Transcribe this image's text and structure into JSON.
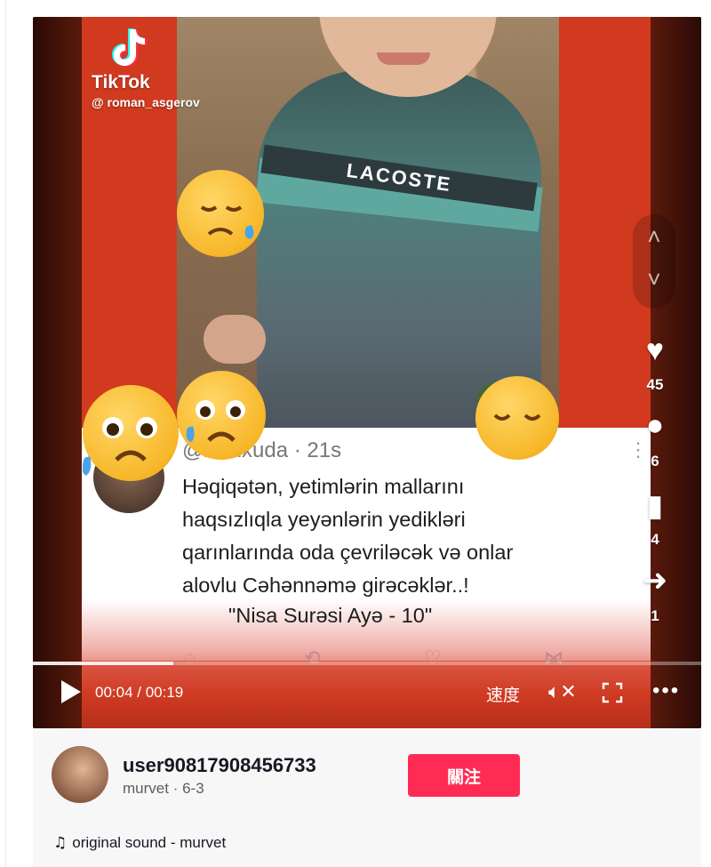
{
  "watermark": {
    "brand": "TikTok",
    "handle": "@ roman_asgerov"
  },
  "video": {
    "sweater_brand": "LACOSTE",
    "card": {
      "handle": "@zikrixuda",
      "age": "· 21s",
      "text_lines": [
        "Həqiqətən, yetimlərin mallarını",
        "haqsızlıqla yeyənlərin yedikləri",
        "qarınlarında oda çevriləcək və onlar",
        "alovlu Cəhənnəmə girəcəklər..!"
      ],
      "citation": "\"Nisa Surəsi Ayə - 10\""
    }
  },
  "rail": {
    "likes": "45",
    "comments": "6",
    "saves": "4",
    "shares": "1"
  },
  "player": {
    "time": "00:04 / 00:19",
    "progress": 0.21,
    "speed_label": "速度"
  },
  "author": {
    "name": "user90817908456733",
    "nickname": "murvet",
    "date": "6-3"
  },
  "follow_label": "關注",
  "sound": {
    "label": "original sound - murvet"
  },
  "colors": {
    "follow": "#fe2c55",
    "video_bg": "#d13a1f"
  }
}
